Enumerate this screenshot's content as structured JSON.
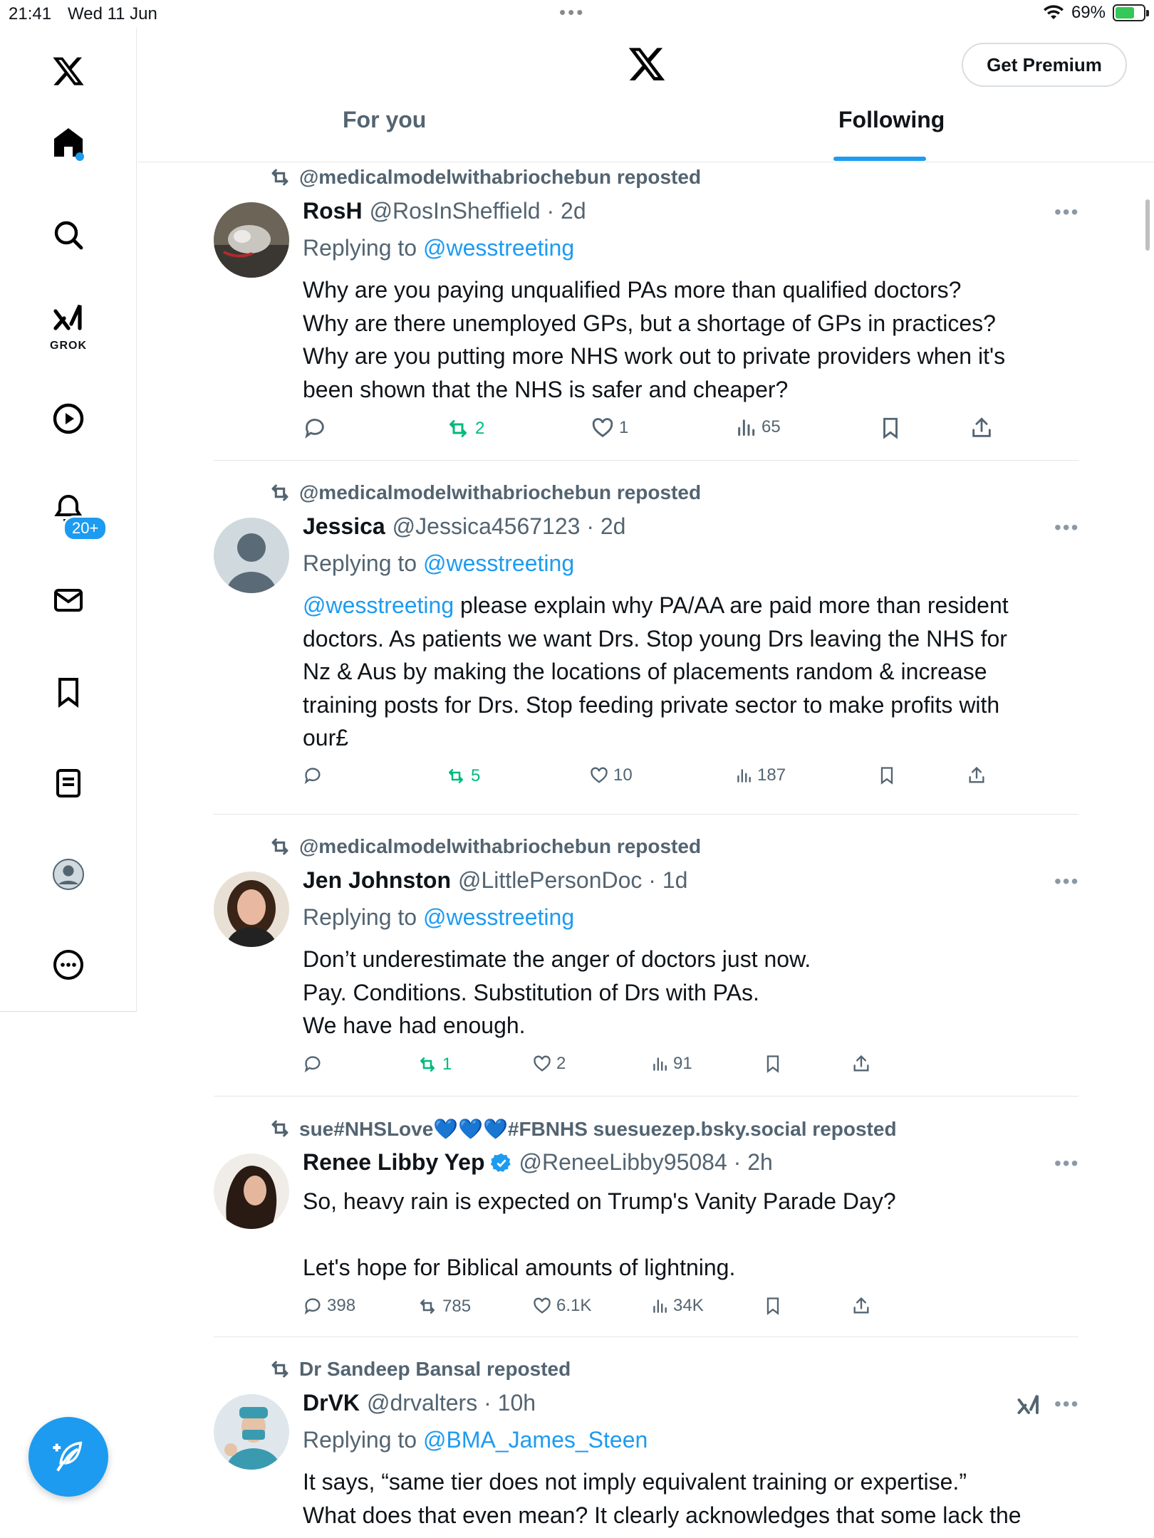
{
  "status_bar": {
    "time": "21:41",
    "date": "Wed 11 Jun",
    "dots": "•••",
    "battery": "69%"
  },
  "sidebar": {
    "grok_label": "GROK",
    "notifications_badge": "20+"
  },
  "header": {
    "premium_label": "Get Premium",
    "tabs": [
      {
        "label": "For you"
      },
      {
        "label": "Following"
      }
    ]
  },
  "tweets": [
    {
      "reposted_by": "@medicalmodelwithabriochebun reposted",
      "name": "RosH",
      "handle": "@RosInSheffield · 2d",
      "replying_prefix": "Replying to ",
      "replying_to": "@wesstreeting",
      "text_lines": [
        "Why are you paying unqualified PAs more than qualified doctors?",
        "Why are there unemployed GPs, but a shortage of GPs in practices?",
        "Why are you putting more NHS work out to private providers when it's",
        "been shown that the NHS is safer and cheaper?"
      ],
      "replies": "",
      "reposts": "2",
      "likes": "1",
      "views": "65"
    },
    {
      "reposted_by": "@medicalmodelwithabriochebun reposted",
      "name": "Jessica",
      "handle": "@Jessica4567123 · 2d",
      "replying_prefix": "Replying to ",
      "replying_to": "@wesstreeting",
      "mention": "@wesstreeting",
      "text_first_line": " please explain why PA/AA are paid more than resident",
      "text_lines": [
        "doctors. As patients we want Drs. Stop young Drs leaving the NHS for",
        "Nz & Aus by making the locations of placements random & increase",
        "training posts for Drs. Stop feeding private sector to make profits with",
        "our£"
      ],
      "replies": "",
      "reposts": "5",
      "likes": "10",
      "views": "187"
    },
    {
      "reposted_by": "@medicalmodelwithabriochebun reposted",
      "name": "Jen Johnston",
      "handle": "@LittlePersonDoc · 1d",
      "replying_prefix": "Replying to ",
      "replying_to": "@wesstreeting",
      "text_lines": [
        "Don’t underestimate the anger of doctors just now.",
        "Pay. Conditions. Substitution of Drs with PAs.",
        "We have had enough."
      ],
      "replies": "",
      "reposts": "1",
      "likes": "2",
      "views": "91"
    },
    {
      "reposted_by": "sue#NHSLove💙💙💙#FBNHS suesuezep.bsky.social reposted",
      "name": "Renee Libby Yep",
      "handle": "@ReneeLibby95084 · 2h",
      "text_lines": [
        "So, heavy rain is expected on Trump's Vanity Parade Day?",
        "",
        "Let's hope for Biblical amounts of lightning."
      ],
      "replies": "398",
      "reposts": "785",
      "likes": "6.1K",
      "views": "34K"
    },
    {
      "reposted_by": "Dr Sandeep Bansal reposted",
      "name": "DrVK",
      "handle": "@drvalters · 10h",
      "replying_prefix": "Replying to ",
      "replying_to": "@BMA_James_Steen",
      "text_lines": [
        "It says, “same tier does not imply equivalent training or expertise.”",
        "What does that even mean? It clearly acknowledges that some lack the"
      ]
    }
  ],
  "colors": {
    "accent": "#1d9bf0",
    "repost_green": "#00ba7c",
    "muted": "#536471"
  }
}
